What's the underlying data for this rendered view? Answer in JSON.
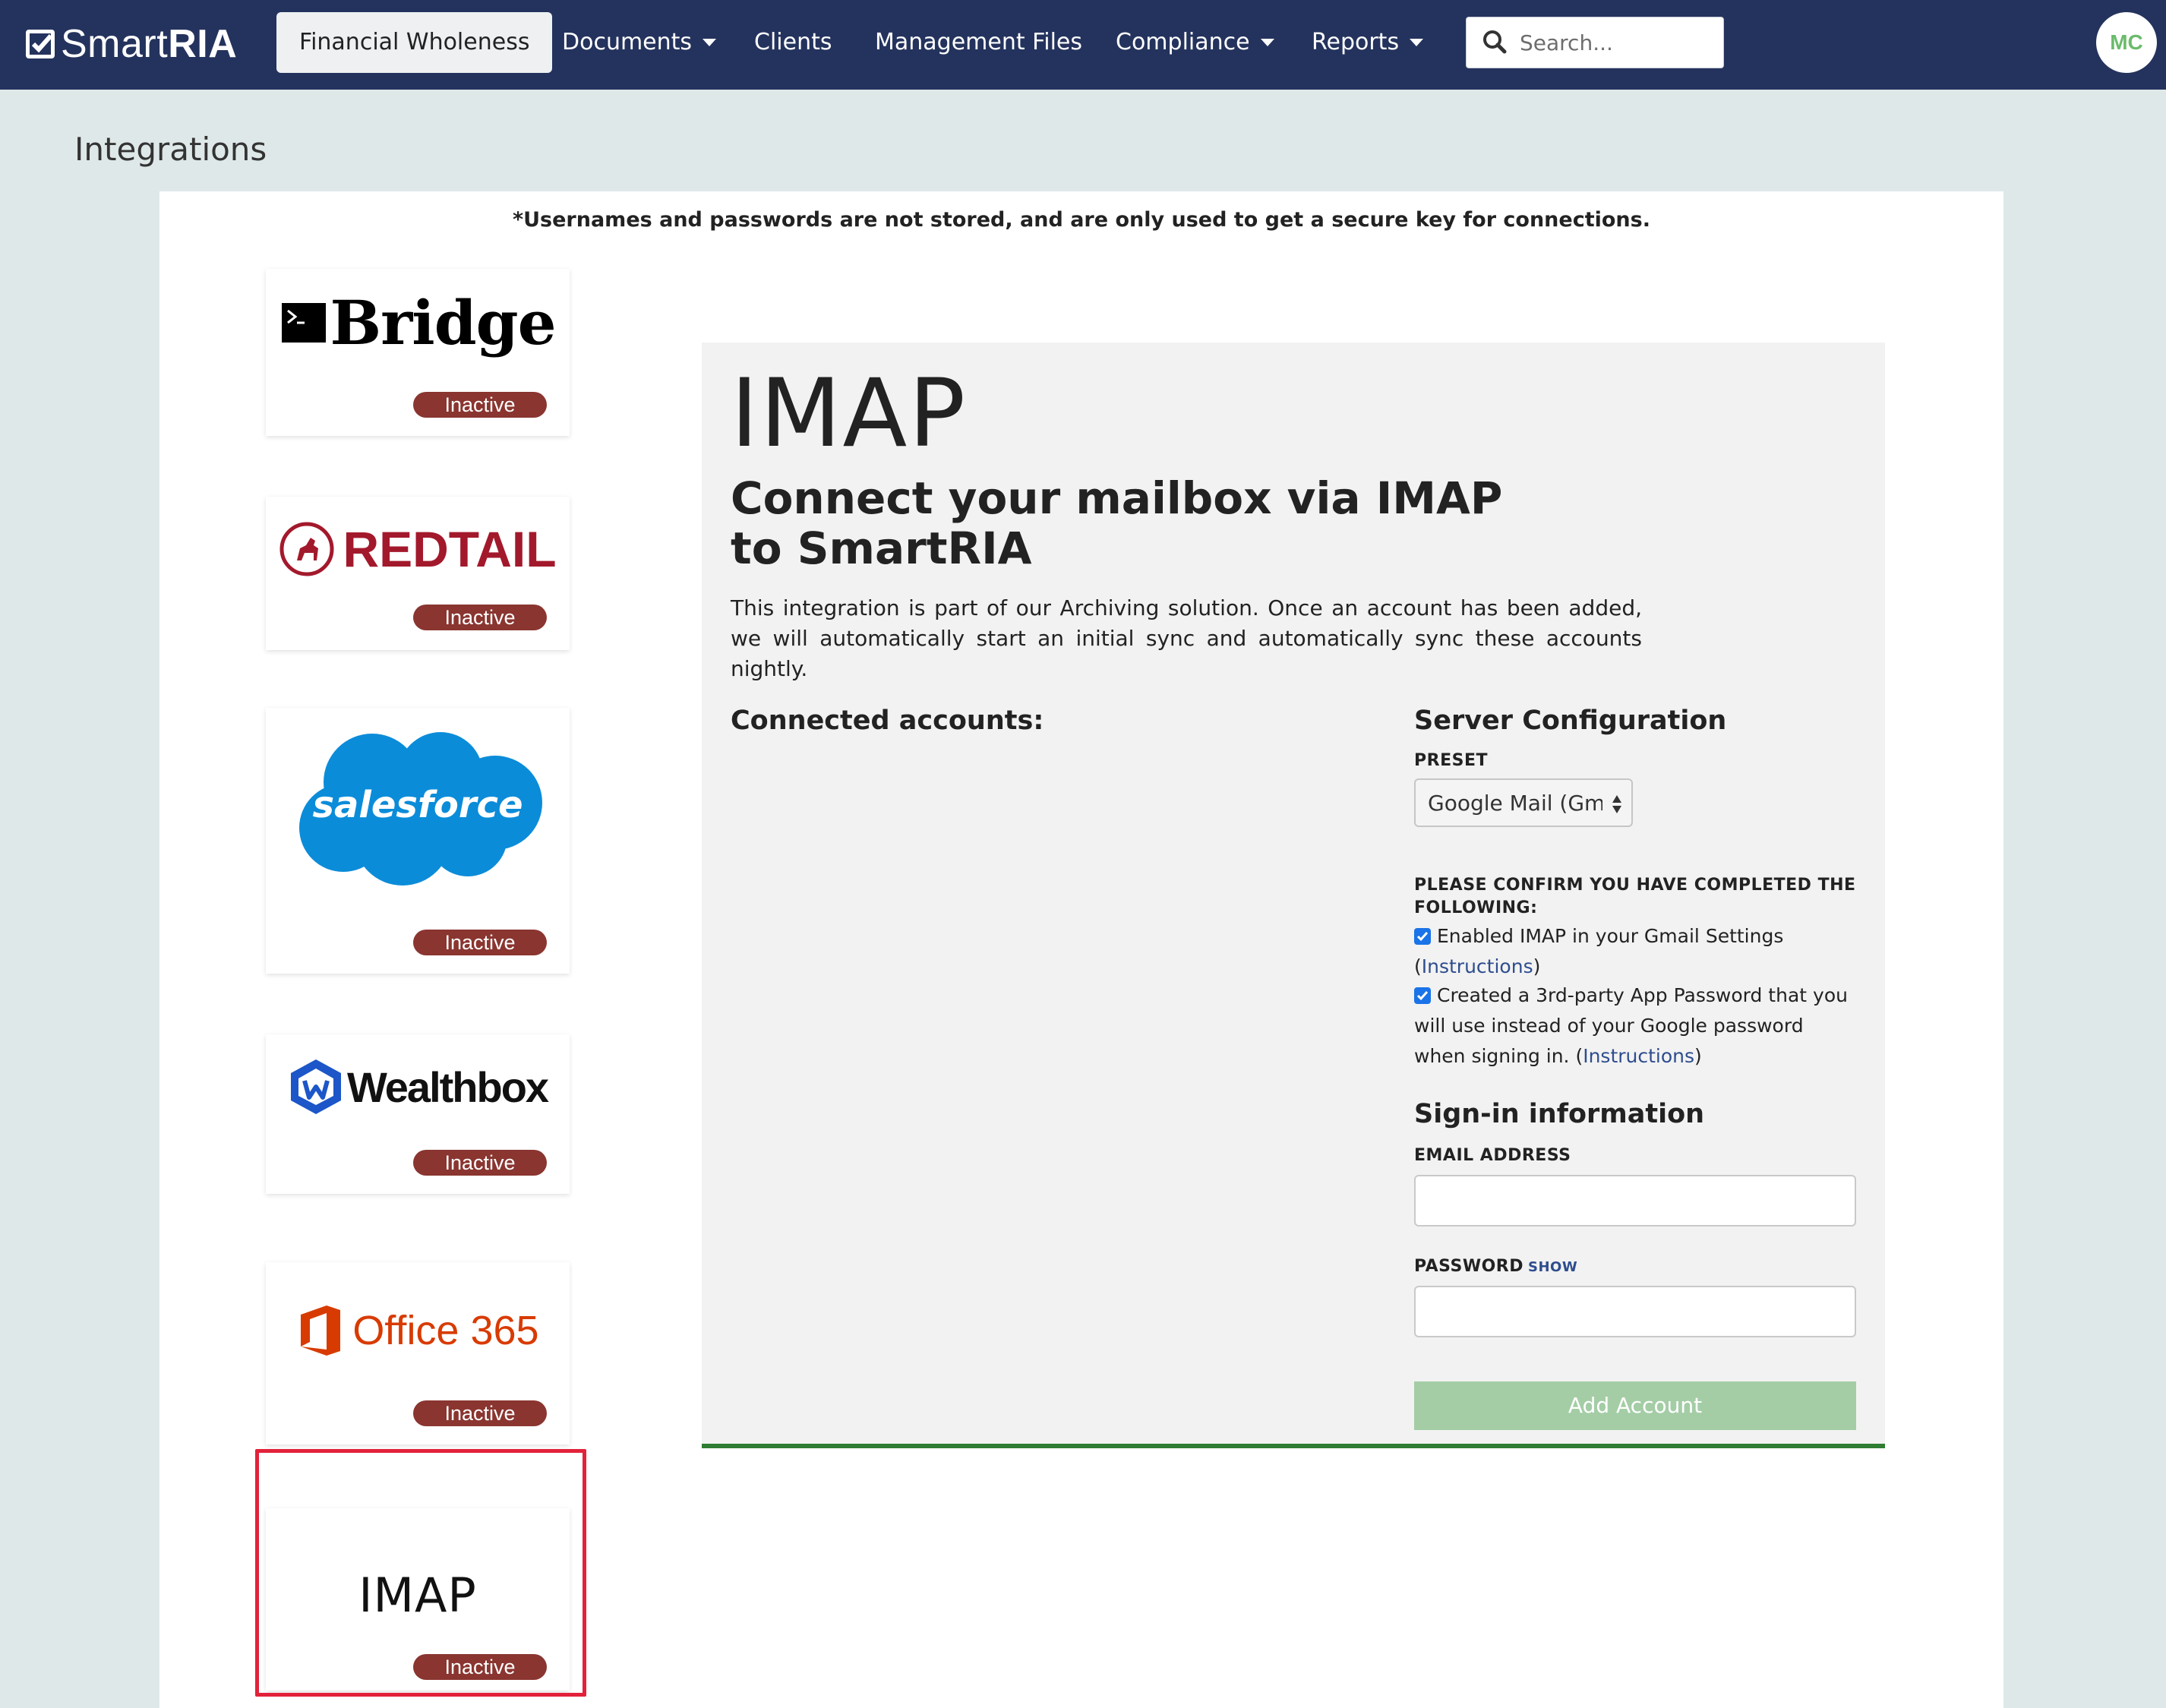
{
  "nav": {
    "brand_light": "Smart",
    "brand_bold": "RIA",
    "items": [
      {
        "label": "Financial Wholeness",
        "active": true
      },
      {
        "label": "Documents",
        "dropdown": true
      },
      {
        "label": "Clients"
      },
      {
        "label": "Management Files"
      },
      {
        "label": "Compliance",
        "dropdown": true
      },
      {
        "label": "Reports",
        "dropdown": true
      }
    ],
    "search_placeholder": "Search...",
    "avatar_initials": "MC"
  },
  "page": {
    "title": "Integrations",
    "notice": "*Usernames and passwords are not stored, and are only used to get a secure key for connections."
  },
  "integrations": [
    {
      "name": "Bridge",
      "status": "Inactive"
    },
    {
      "name": "REDTAIL",
      "status": "Inactive"
    },
    {
      "name": "salesforce",
      "status": "Inactive"
    },
    {
      "name": "Wealthbox",
      "status": "Inactive"
    },
    {
      "name": "Office 365",
      "status": "Inactive"
    },
    {
      "name": "IMAP",
      "status": "Inactive",
      "selected": true
    }
  ],
  "detail": {
    "title": "IMAP",
    "heading": "Connect your mailbox via IMAP to SmartRIA",
    "description": "This integration is part of our Archiving solution. Once an account has been added, we will automatically start an initial sync and automatically sync these accounts nightly.",
    "connected_label": "Connected accounts:",
    "server": {
      "title": "Server Configuration",
      "preset_label": "PRESET",
      "preset_value": "Google Mail (Gmail)",
      "confirm_label": "PLEASE CONFIRM YOU HAVE COMPLETED THE FOLLOWING:",
      "check1_text": "Enabled IMAP in your Gmail Settings",
      "check1_link": "Instructions",
      "check1_checked": true,
      "check2_text": "Created a 3rd-party App Password that you will use instead of your Google password when signing in.",
      "check2_link": "Instructions",
      "check2_checked": true
    },
    "signin": {
      "title": "Sign-in information",
      "email_label": "EMAIL ADDRESS",
      "email_value": "",
      "password_label": "PASSWORD",
      "show_label": "SHOW",
      "password_value": "",
      "button_label": "Add Account"
    }
  },
  "colors": {
    "nav_bg": "#24335d",
    "page_bg": "#dfe8e8",
    "badge_bg": "#8a3530",
    "accent_green": "#2f7d32",
    "button_disabled": "#a4cda6",
    "selection_outline": "#e2223b",
    "redtail": "#a3192c",
    "salesforce": "#0b8cd9",
    "wealthbox": "#1c56c8",
    "office": "#d83b01"
  }
}
